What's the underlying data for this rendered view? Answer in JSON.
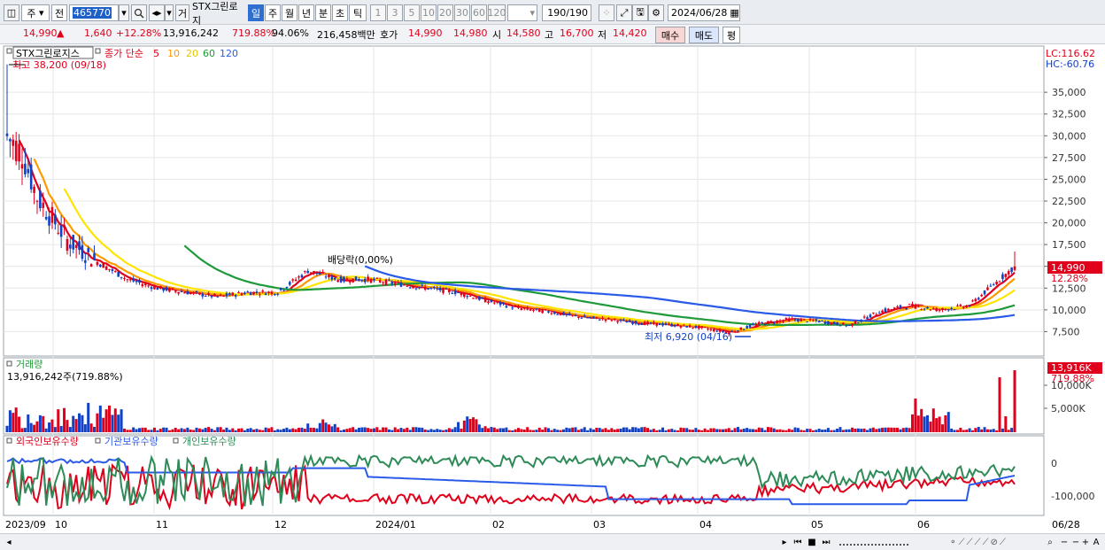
{
  "toolbar": {
    "period_select": "주",
    "prev_label": "전",
    "code": "465770",
    "search_icon": "search-icon",
    "trade_label": "거",
    "stock_name": "STX그린로지",
    "periods": [
      "일",
      "주",
      "월",
      "년",
      "분",
      "초",
      "틱"
    ],
    "active_period": "일",
    "intervals": [
      "1",
      "3",
      "5",
      "10",
      "20",
      "30",
      "60",
      "120"
    ],
    "count": "190",
    "count_total": "/190",
    "date": "2024/06/28"
  },
  "quote": {
    "price": "14,990",
    "arrow": "▲",
    "change": "1,640",
    "change_pct": "+12.28%",
    "volume": "13,916,242",
    "volume_pct": "719.88%",
    "turnover_pct": "94.06%",
    "amount": "216,458백만",
    "ask_label": "호가",
    "ask": "14,990",
    "bid": "14,980",
    "open_label": "시",
    "open": "14,580",
    "high_label": "고",
    "high": "16,700",
    "low_label": "저",
    "low": "14,420",
    "buy_label": "매수",
    "sell_label": "매도",
    "eval_label": "평"
  },
  "price_panel": {
    "stock_legend": "STX그린로지스",
    "ma_label": "종가 단순",
    "ma_periods": [
      "5",
      "10",
      "20",
      "60",
      "120"
    ],
    "ma_colors": [
      "#e0001b",
      "#ff9900",
      "#ffe400",
      "#1e9a3a",
      "#2a5be8"
    ],
    "high_note": "최고 38,200 (09/18)",
    "low_note": "최저 6,920 (04/16)",
    "dividend_note": "배당락(0,00%)",
    "lc": "LC:116.62",
    "hc": "HC:-60.76",
    "current_tag": "14,990",
    "current_pct": "12.28%",
    "y_ticks": [
      "35,000",
      "32,500",
      "30,000",
      "27,500",
      "25,000",
      "22,500",
      "20,000",
      "17,500",
      "15,000",
      "12,500",
      "10,000",
      "7,500"
    ]
  },
  "volume_panel": {
    "title": "거래량",
    "value": "13,916,242주(719.88%)",
    "tag": "13,916K",
    "tag_pct": "719.88%",
    "y_ticks": [
      "10,000K",
      "5,000K"
    ]
  },
  "holder_panel": {
    "legend": [
      "외국인보유수량",
      "기관보유수량",
      "개인보유수량"
    ],
    "legend_colors": [
      "#e0001b",
      "#2a5be8",
      "#2e8b57"
    ],
    "y_ticks": [
      "0",
      "-100,000"
    ]
  },
  "x_axis": {
    "labels": [
      "2023/09",
      "10",
      "11",
      "12",
      "2024/01",
      "02",
      "03",
      "04",
      "05",
      "06",
      "06/28"
    ]
  },
  "chart_data": {
    "type": "candlestick",
    "ylim": [
      5000,
      40000
    ],
    "series": [
      {
        "name": "5",
        "color": "#e0001b"
      },
      {
        "name": "10",
        "color": "#ff9900"
      },
      {
        "name": "20",
        "color": "#ffe400"
      },
      {
        "name": "60",
        "color": "#1e9a3a"
      },
      {
        "name": "120",
        "color": "#2a5be8"
      }
    ],
    "close_path_keypoints": [
      [
        0,
        30000
      ],
      [
        5,
        28000
      ],
      [
        10,
        23000
      ],
      [
        20,
        18000
      ],
      [
        30,
        15500
      ],
      [
        40,
        13500
      ],
      [
        50,
        12500
      ],
      [
        60,
        12000
      ],
      [
        70,
        11500
      ],
      [
        80,
        12000
      ],
      [
        90,
        12000
      ],
      [
        100,
        14500
      ],
      [
        110,
        13500
      ],
      [
        120,
        13500
      ],
      [
        130,
        13000
      ],
      [
        140,
        12500
      ],
      [
        150,
        12000
      ],
      [
        160,
        11000
      ],
      [
        170,
        10200
      ],
      [
        180,
        9800
      ],
      [
        190,
        9200
      ],
      [
        200,
        8900
      ],
      [
        210,
        8500
      ],
      [
        220,
        8300
      ],
      [
        230,
        8000
      ],
      [
        240,
        7400
      ],
      [
        250,
        8400
      ],
      [
        260,
        8900
      ],
      [
        270,
        8700
      ],
      [
        280,
        8200
      ],
      [
        290,
        9800
      ],
      [
        300,
        10500
      ],
      [
        310,
        10000
      ],
      [
        320,
        10500
      ],
      [
        330,
        13500
      ],
      [
        335,
        14990
      ]
    ]
  }
}
